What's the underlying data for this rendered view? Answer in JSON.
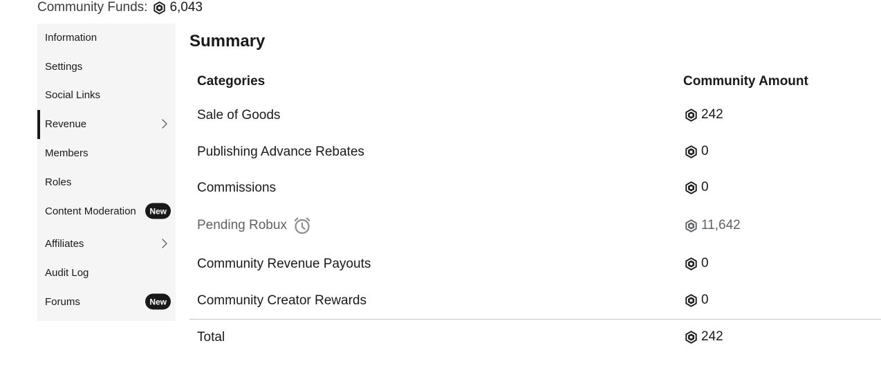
{
  "funds": {
    "label": "Community Funds:",
    "value": "6,043",
    "icon": "robux-icon"
  },
  "sidebar": {
    "items": [
      {
        "label": "Information"
      },
      {
        "label": "Settings"
      },
      {
        "label": "Social Links"
      },
      {
        "label": "Revenue",
        "active": true,
        "chevron": "chevron-right-icon"
      },
      {
        "label": "Members"
      },
      {
        "label": "Roles"
      },
      {
        "label": "Content Moderation",
        "badge": "New"
      },
      {
        "label": "Affiliates",
        "chevron": "chevron-right-icon"
      },
      {
        "label": "Audit Log"
      },
      {
        "label": "Forums",
        "badge": "New"
      }
    ]
  },
  "summary": {
    "title": "Summary",
    "col_category": "Categories",
    "col_amount": "Community Amount",
    "rows": [
      {
        "category": "Sale of Goods",
        "amount": "242"
      },
      {
        "category": "Publishing Advance Rebates",
        "amount": "0"
      },
      {
        "category": "Commissions",
        "amount": "0"
      },
      {
        "category": "Pending Robux",
        "amount": "11,642",
        "pending": true,
        "icon": "clock-icon"
      },
      {
        "category": "Community Revenue Payouts",
        "amount": "0"
      },
      {
        "category": "Community Creator Rewards",
        "amount": "0"
      }
    ],
    "total": {
      "label": "Total",
      "amount": "242"
    }
  },
  "colors": {
    "text": "#191919",
    "muted": "#5f6163",
    "sidebar_bg": "#f5f5f5",
    "badge_bg": "#191919"
  }
}
